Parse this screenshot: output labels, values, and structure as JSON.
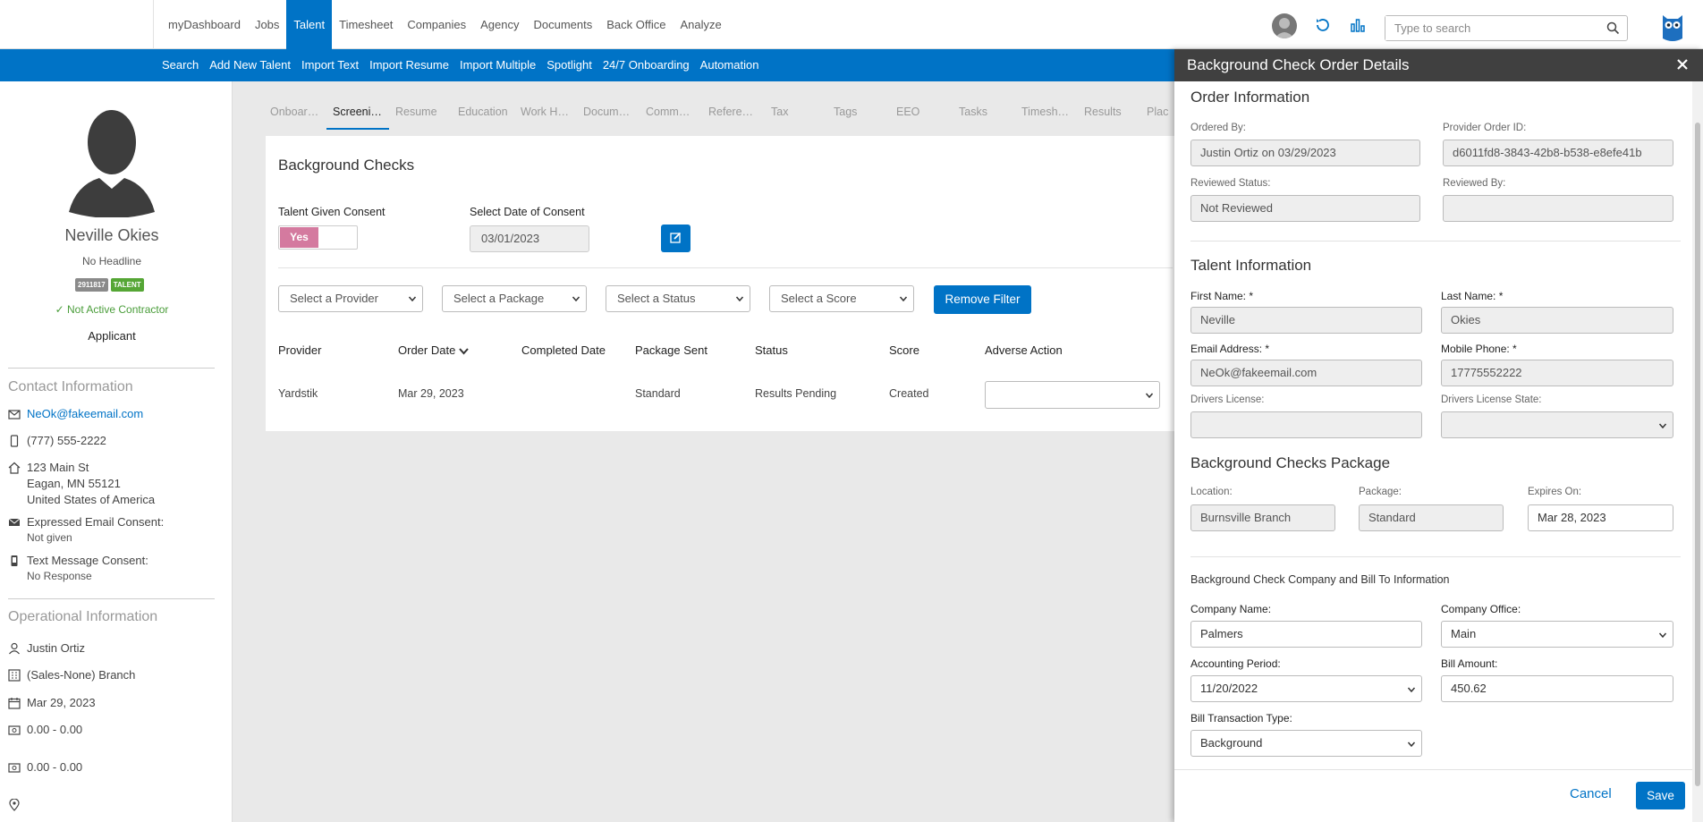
{
  "topnav": {
    "items": [
      "myDashboard",
      "Jobs",
      "Talent",
      "Timesheet",
      "Companies",
      "Agency",
      "Documents",
      "Back Office",
      "Analyze"
    ],
    "active_index": 2,
    "search_placeholder": "Type to search"
  },
  "subnav": {
    "items": [
      "Search",
      "Add New Talent",
      "Import Text",
      "Import Resume",
      "Import Multiple",
      "Spotlight",
      "24/7 Onboarding",
      "Automation"
    ]
  },
  "profile": {
    "name": "Neville Okies",
    "headline": "No Headline",
    "badge_id": "2911817",
    "badge_type": "TALENT",
    "status": "Not Active Contractor",
    "role": "Applicant",
    "contact_title": "Contact Information",
    "email": "NeOk@fakeemail.com",
    "phone": "(777) 555-2222",
    "address_line1": "123 Main St",
    "address_line2": "Eagan, MN 55121",
    "address_line3": "United States of America",
    "email_consent_label": "Expressed Email Consent:",
    "email_consent_value": "Not given",
    "text_consent_label": "Text Message Consent:",
    "text_consent_value": "No Response",
    "operational_title": "Operational Information",
    "recruiter": "Justin Ortiz",
    "branch": "(Sales-None) Branch",
    "date": "Mar 29, 2023",
    "pay_range_1": "0.00 - 0.00",
    "pay_range_2": "0.00 - 0.00"
  },
  "tabs": [
    "Onboardi...",
    "Screenin...",
    "Resume",
    "Education",
    "Work Hist...",
    "Docume...",
    "Commen...",
    "Referenc...",
    "Tax",
    "Tags",
    "EEO",
    "Tasks",
    "Timeshe...",
    "Results",
    "Plac"
  ],
  "active_tab": 1,
  "bg": {
    "title": "Background Checks",
    "consent_label": "Talent Given Consent",
    "consent_value": "Yes",
    "date_label": "Select Date of Consent",
    "date_value": "03/01/2023",
    "filters": [
      "Select a Provider",
      "Select a Package",
      "Select a Status",
      "Select a Score"
    ],
    "remove_filter": "Remove Filter",
    "columns": [
      "Provider",
      "Order Date",
      "Completed Date",
      "Package Sent",
      "Status",
      "Score",
      "Adverse Action"
    ],
    "row": {
      "provider": "Yardstik",
      "order_date": "Mar 29, 2023",
      "completed_date": "",
      "package": "Standard",
      "status": "Results Pending",
      "score": "Created"
    }
  },
  "panel": {
    "title": "Background Check Order Details",
    "order_title": "Order Information",
    "ordered_by_label": "Ordered By:",
    "ordered_by_value": "Justin Ortiz on 03/29/2023",
    "provider_order_label": "Provider Order ID:",
    "provider_order_value": "d6011fd8-3843-42b8-b538-e8efe41b",
    "reviewed_status_label": "Reviewed Status:",
    "reviewed_status_value": "Not Reviewed",
    "reviewed_by_label": "Reviewed By:",
    "reviewed_by_value": "",
    "talent_title": "Talent Information",
    "first_name_label": "First Name: *",
    "first_name_value": "Neville",
    "last_name_label": "Last Name: *",
    "last_name_value": "Okies",
    "email_label": "Email Address: *",
    "email_value": "NeOk@fakeemail.com",
    "mobile_label": "Mobile Phone: *",
    "mobile_value": "17775552222",
    "dl_label": "Drivers License:",
    "dl_value": "",
    "dl_state_label": "Drivers License State:",
    "dl_state_value": "",
    "package_title": "Background Checks Package",
    "location_label": "Location:",
    "location_value": "Burnsville Branch",
    "package_label": "Package:",
    "package_value": "Standard",
    "expires_label": "Expires On:",
    "expires_value": "Mar 28, 2023",
    "company_section_title": "Background Check Company and Bill To Information",
    "company_name_label": "Company Name:",
    "company_name_value": "Palmers",
    "company_office_label": "Company Office:",
    "company_office_value": "Main",
    "acct_period_label": "Accounting Period:",
    "acct_period_value": "11/20/2022",
    "bill_amount_label": "Bill Amount:",
    "bill_amount_value": "450.62",
    "bill_type_label": "Bill Transaction Type:",
    "bill_type_value": "Background",
    "cancel": "Cancel",
    "save": "Save"
  },
  "colors": {
    "primary": "#0073c6",
    "panel_header": "#404040",
    "toggle_on": "#d47a9f",
    "success": "#4a9d3a",
    "talent_badge": "#55a635"
  }
}
